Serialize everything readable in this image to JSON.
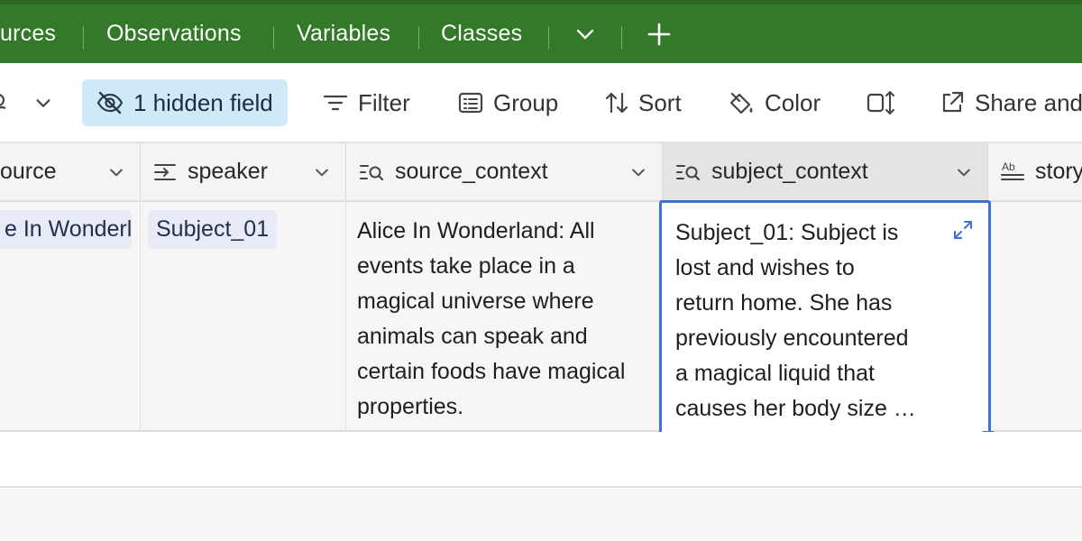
{
  "tabs": [
    {
      "label": "urces"
    },
    {
      "label": "Observations"
    },
    {
      "label": "Variables"
    },
    {
      "label": "Classes"
    }
  ],
  "toolbar": {
    "hidden_fields_label": "1 hidden field",
    "filter_label": "Filter",
    "group_label": "Group",
    "sort_label": "Sort",
    "color_label": "Color",
    "share_label": "Share and"
  },
  "columns": [
    {
      "label": "ource"
    },
    {
      "label": "speaker"
    },
    {
      "label": "source_context"
    },
    {
      "label": "subject_context"
    },
    {
      "label": "story"
    }
  ],
  "row": {
    "source": "e In Wonderla",
    "speaker": "Subject_01",
    "source_context_lines": [
      "Alice In Wonderland: All",
      "events take place in a",
      "magical universe where",
      "animals can speak and",
      "certain foods have magical",
      "properties."
    ],
    "subject_context_lines": [
      "Subject_01: Subject is",
      "lost and wishes to",
      "return home. She has",
      "previously encountered",
      "a magical liquid that",
      "causes her body size …"
    ]
  },
  "colors": {
    "tabbar": "#34782a",
    "accent": "#3a72d6",
    "hidden_field_bg": "#cfe9f8"
  }
}
